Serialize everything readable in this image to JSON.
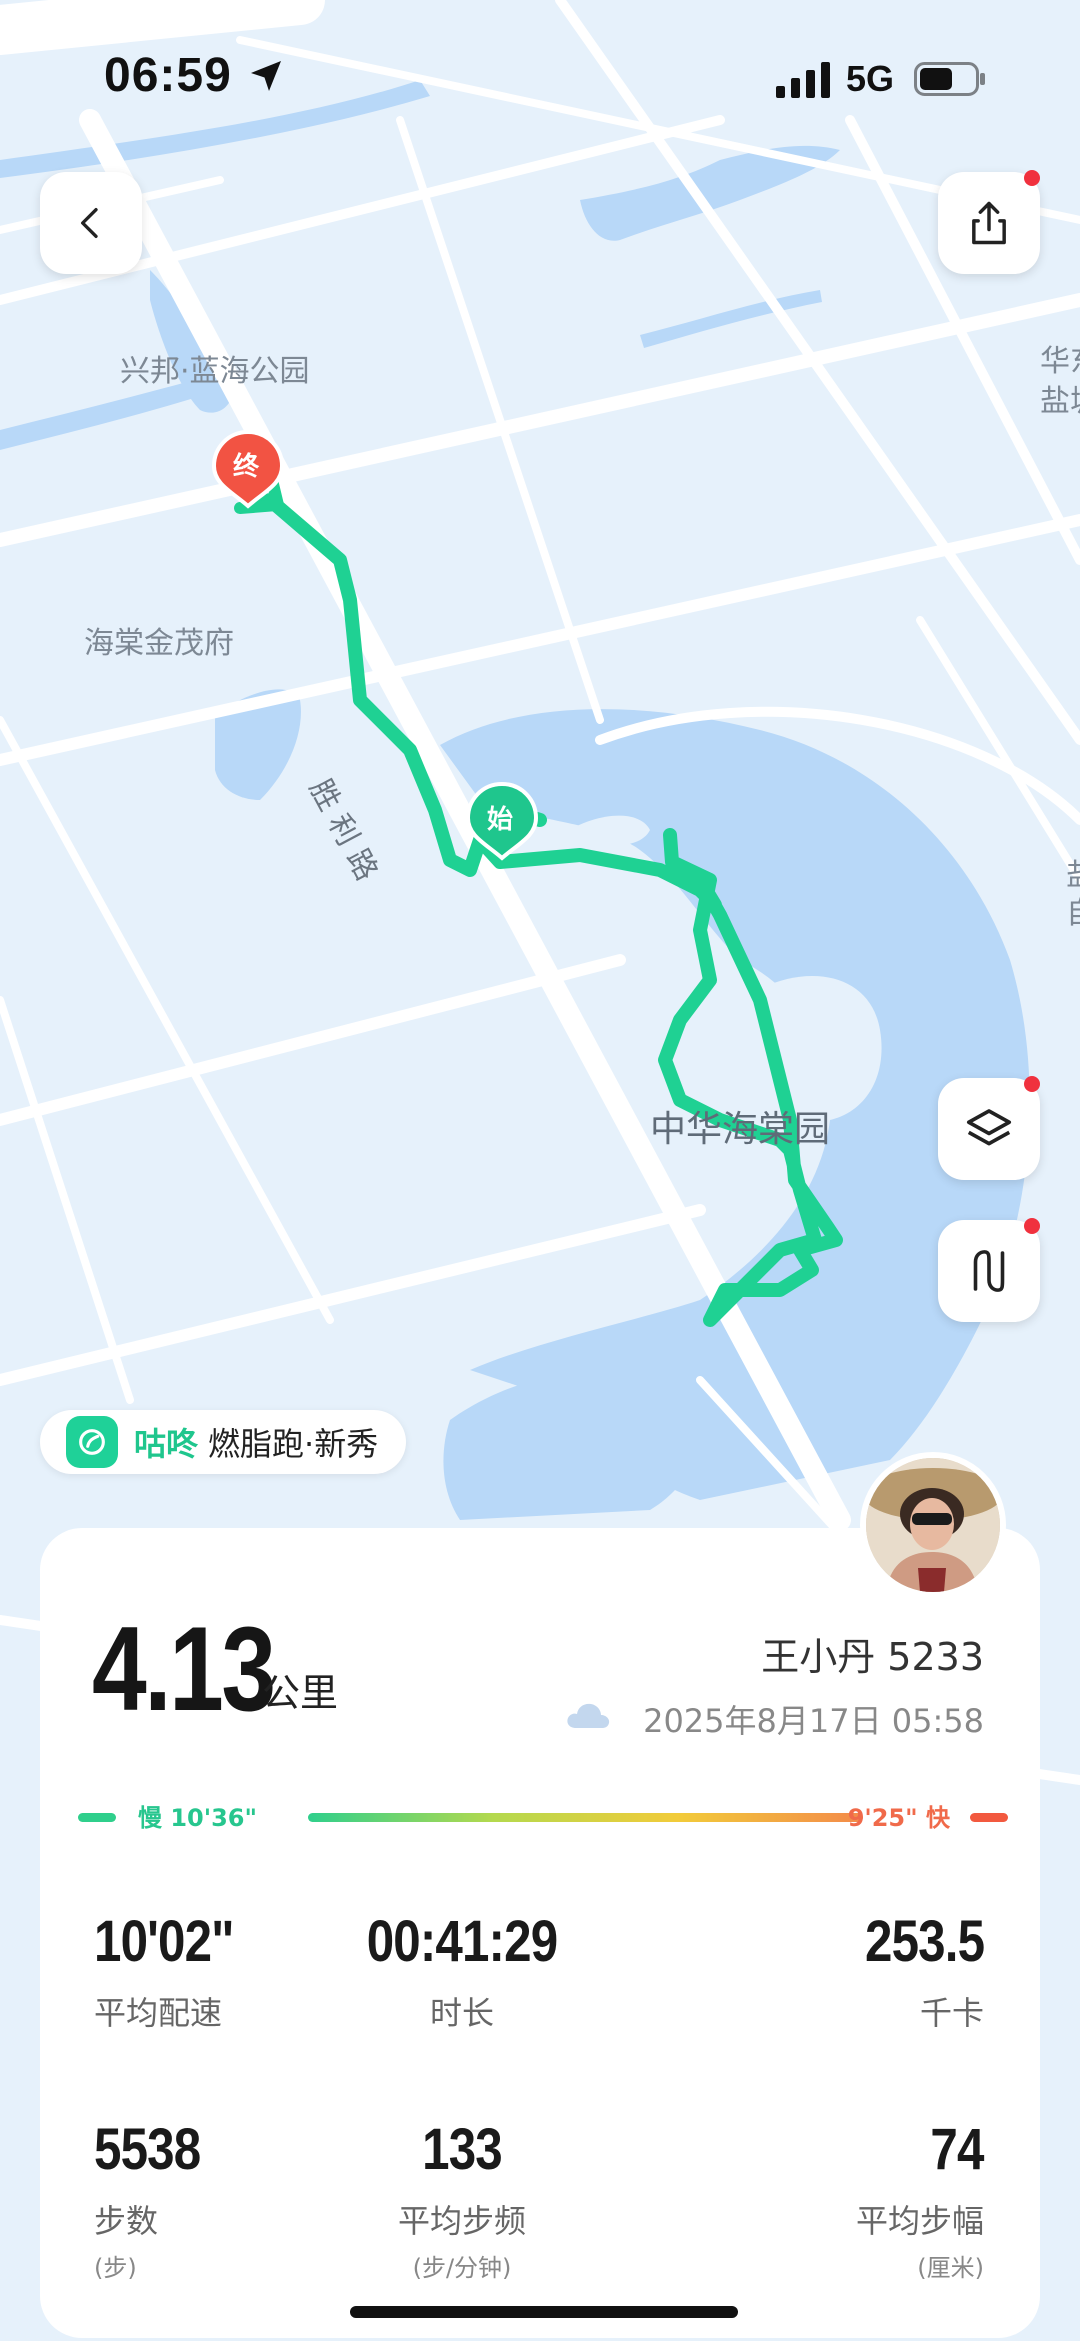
{
  "status_bar": {
    "time": "06:59",
    "network": "5G"
  },
  "map": {
    "labels": [
      "兴邦·蓝海公园",
      "海棠金茂府",
      "胜 利 路",
      "中华海棠园",
      "华东",
      "盐城",
      "盐",
      "自"
    ],
    "start_marker": "始",
    "end_marker": "终"
  },
  "brand": {
    "name": "咕咚",
    "tag": "燃脂跑·新秀"
  },
  "summary": {
    "distance": "4.13",
    "distance_unit": "公里",
    "user": "王小丹 5233",
    "datetime": "2025年8月17日 05:58"
  },
  "pace_bar": {
    "slow": "慢 10'36\"",
    "fast": "9'25\" 快"
  },
  "stats": [
    {
      "value": "10'02\"",
      "label": "平均配速",
      "sub": ""
    },
    {
      "value": "00:41:29",
      "label": "时长",
      "sub": ""
    },
    {
      "value": "253.5",
      "label": "千卡",
      "sub": ""
    },
    {
      "value": "5538",
      "label": "步数",
      "sub": "(步)"
    },
    {
      "value": "133",
      "label": "平均步频",
      "sub": "(步/分钟)"
    },
    {
      "value": "74",
      "label": "平均步幅",
      "sub": "(厘米)"
    }
  ],
  "colors": {
    "route": "#1fd193",
    "end_marker": "#f25343",
    "start_marker": "#1fc68d",
    "water": "#b8d8f8",
    "land": "#e6f1fb"
  },
  "icons": [
    "back-icon",
    "share-icon",
    "layers-icon",
    "route-icon",
    "cloud-icon",
    "location-arrow-icon",
    "signal-icon",
    "battery-icon"
  ]
}
